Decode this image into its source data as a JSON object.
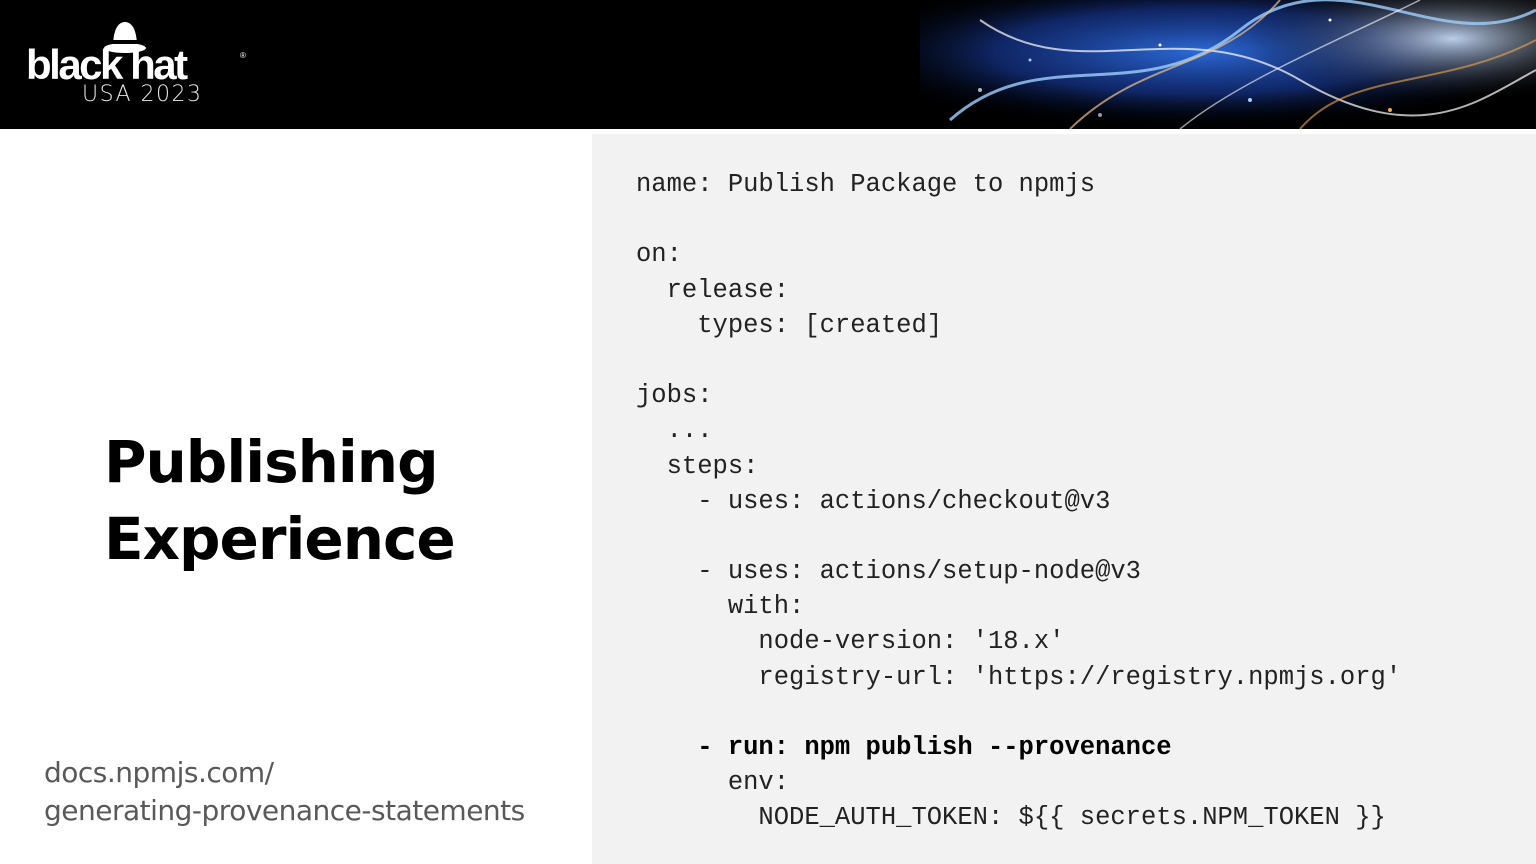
{
  "header": {
    "brand_name": "black hat",
    "brand_subtitle": "USA 2023"
  },
  "slide": {
    "title_line1": "Publishing",
    "title_line2": "Experience",
    "link_line1": "docs.npmjs.com/",
    "link_line2": "generating-provenance-statements"
  },
  "code": {
    "lines": [
      "name: Publish Package to npmjs",
      "",
      "on:",
      "  release:",
      "    types: [created]",
      "",
      "jobs:",
      "  ...",
      "  steps:",
      "    - uses: actions/checkout@v3",
      "",
      "    - uses: actions/setup-node@v3",
      "      with:",
      "        node-version: '18.x'",
      "        registry-url: 'https://registry.npmjs.org'",
      "",
      "    - run: npm publish --provenance",
      "      env:",
      "        NODE_AUTH_TOKEN: ${{ secrets.NPM_TOKEN }}"
    ]
  }
}
